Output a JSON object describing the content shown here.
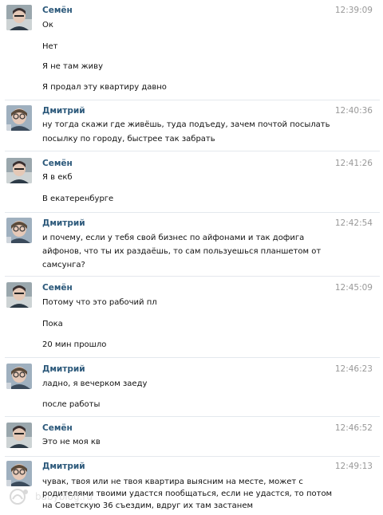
{
  "messages": [
    {
      "author": "Семён",
      "avatar": "semyon",
      "time": "12:39:09",
      "lines": [
        "Ок",
        "Нет",
        "Я не там живу",
        "Я продал эту квартиру давно"
      ]
    },
    {
      "author": "Дмитрий",
      "avatar": "dmitry",
      "time": "12:40:36",
      "lines": [
        "ну тогда скажи где живёшь, туда подъеду, зачем почтой посылать",
        "посылку по городу, быстрее так забрать"
      ]
    },
    {
      "author": "Семён",
      "avatar": "semyon",
      "time": "12:41:26",
      "lines": [
        "Я в екб",
        "В екатеренбурге"
      ]
    },
    {
      "author": "Дмитрий",
      "avatar": "dmitry",
      "time": "12:42:54",
      "lines": [
        "и почему, если у тебя свой бизнес по айфонами и так дофига",
        "айфонов, что ты их раздаёшь, то сам пользуешься планшетом от",
        "самсунга?"
      ]
    },
    {
      "author": "Семён",
      "avatar": "semyon",
      "time": "12:45:09",
      "lines": [
        "Потому что это рабочий пл",
        "Пока",
        "20 мин прошло"
      ]
    },
    {
      "author": "Дмитрий",
      "avatar": "dmitry",
      "time": "12:46:23",
      "lines": [
        "ладно, я вечерком заеду",
        "после работы"
      ]
    },
    {
      "author": "Семён",
      "avatar": "semyon",
      "time": "12:46:52",
      "lines": [
        "Это не моя кв"
      ]
    },
    {
      "author": "Дмитрий",
      "avatar": "dmitry",
      "time": "12:49:13",
      "lines": [
        "чувак, твоя или не твоя квартира выясним на месте, может с",
        "родителями твоими удастся пообщаться, если не удастся, то потом",
        "на Советскую 36 съездим, вдруг их там застанем"
      ]
    }
  ],
  "watermark": {
    "text": "babyblog.ru",
    "icon": "babyblog-logo-icon"
  },
  "colors": {
    "author": "#2b587a",
    "time": "#999999",
    "text": "#111111",
    "divider": "#e4e8ed"
  }
}
